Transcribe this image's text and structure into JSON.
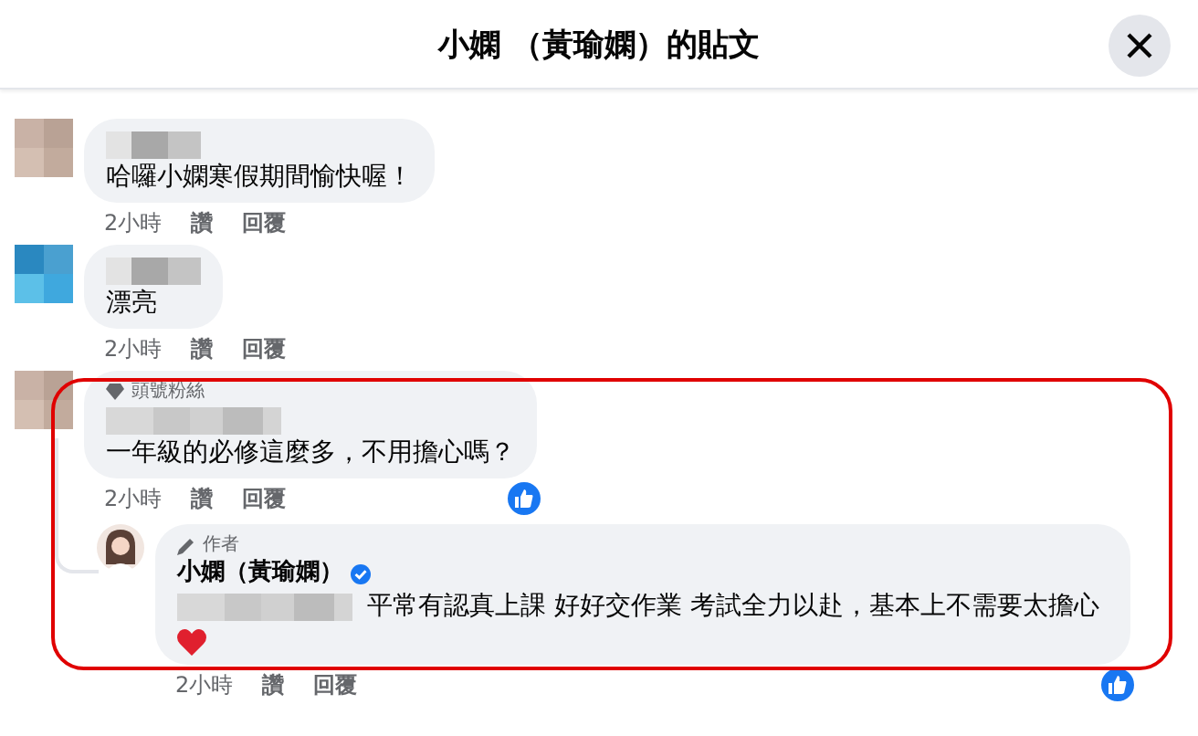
{
  "header": {
    "title": "小嫻 （黃瑜嫻）的貼文"
  },
  "comments": [
    {
      "redacted_name": true,
      "text": "哈囉小嫻寒假期間愉快喔！",
      "time": "2小時",
      "like": "讚",
      "reply": "回覆",
      "liked": false,
      "highlighted": false
    },
    {
      "redacted_name": true,
      "text": "漂亮",
      "time": "2小時",
      "like": "讚",
      "reply": "回覆",
      "liked": false,
      "highlighted": false
    },
    {
      "badge": {
        "kind": "top_fan",
        "label": "頭號粉絲"
      },
      "redacted_name": true,
      "text": "一年級的必修這麼多，不用擔心嗎？",
      "time": "2小時",
      "like": "讚",
      "reply": "回覆",
      "liked": true,
      "highlighted": true,
      "replies": [
        {
          "badge": {
            "kind": "author",
            "label": "作者"
          },
          "name": "小嫻（黃瑜嫻）",
          "verified": true,
          "redacted_mention": true,
          "text": "平常有認真上課 好好交作業 考試全力以赴，基本上不需要太擔心",
          "heart": true,
          "time": "2小時",
          "like": "讚",
          "reply": "回覆",
          "liked": true
        }
      ]
    }
  ]
}
